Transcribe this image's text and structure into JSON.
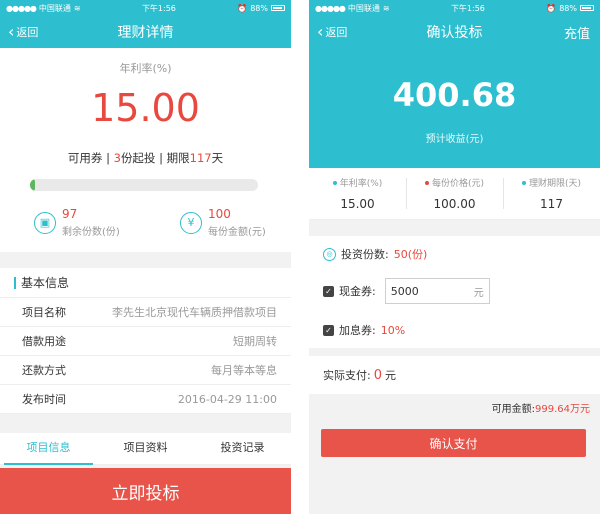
{
  "left": {
    "status": {
      "carrier": "中国联通",
      "time": "下午1:56",
      "battery": "88%"
    },
    "nav": {
      "back": "返回",
      "title": "理财详情"
    },
    "rate": {
      "label": "年利率(%)",
      "value": "15.00",
      "meta_coupon": "可用券",
      "meta_divider1": "|",
      "meta_min": "3",
      "meta_min_suffix": "份起投",
      "meta_divider2": "|",
      "meta_term_prefix": "期限",
      "meta_term": "117",
      "meta_term_suffix": "天",
      "progress_fraction": 0.02
    },
    "stats": [
      {
        "icon": "document-icon",
        "value": "97",
        "caption": "剩余份数(份)"
      },
      {
        "icon": "yen-icon",
        "value": "100",
        "caption": "每份金额(元)"
      }
    ],
    "info": {
      "heading": "基本信息",
      "rows": [
        {
          "key": "项目名称",
          "value": "李先生北京现代车辆质押借款项目"
        },
        {
          "key": "借款用途",
          "value": "短期周转"
        },
        {
          "key": "还款方式",
          "value": "每月等本等息"
        },
        {
          "key": "发布时间",
          "value": "2016-04-29 11:00"
        }
      ]
    },
    "tabs": [
      "项目信息",
      "项目资料",
      "投资记录"
    ],
    "action": "立即投标"
  },
  "right": {
    "status": {
      "carrier": "中国联通",
      "time": "下午1:56",
      "battery": "88%"
    },
    "nav": {
      "back": "返回",
      "title": "确认投标",
      "action": "充值"
    },
    "hero": {
      "amount": "400.68",
      "caption": "预计收益(元)"
    },
    "metrics": [
      {
        "label": "年利率(%)",
        "value": "15.00",
        "dot_color": "#2dbfcf"
      },
      {
        "label": "每份价格(元)",
        "value": "100.00",
        "dot_color": "#e8483d"
      },
      {
        "label": "理财期限(天)",
        "value": "117",
        "dot_color": "#2dbfcf"
      }
    ],
    "form": {
      "shares_label": "投资份数:",
      "shares_value": "50(份)",
      "cash_label": "现金券:",
      "cash_value": "5000",
      "cash_unit": "元",
      "bonus_label": "加息券:",
      "bonus_value": "10%"
    },
    "pay": {
      "label": "实际支付:",
      "amount": "0",
      "unit": "元"
    },
    "avail": {
      "label": "可用金额:",
      "amount": "999.64",
      "unit": "万元"
    },
    "confirm": "确认支付"
  },
  "colors": {
    "accent": "#2dbfcf",
    "danger": "#e8483d",
    "progress": "#5cb85c"
  }
}
